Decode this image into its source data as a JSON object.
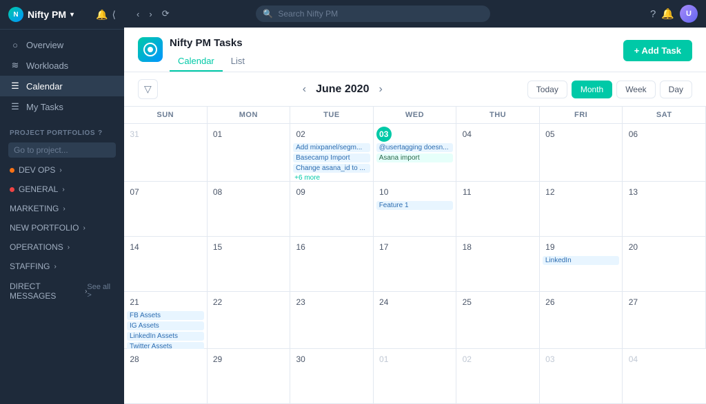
{
  "app": {
    "name": "Nifty PM",
    "search_placeholder": "Search Nifty PM"
  },
  "sidebar": {
    "nav": [
      {
        "id": "overview",
        "label": "Overview",
        "icon": "○"
      },
      {
        "id": "workloads",
        "label": "Workloads",
        "icon": "📊"
      },
      {
        "id": "calendar",
        "label": "Calendar",
        "icon": "☰",
        "active": true
      },
      {
        "id": "my-tasks",
        "label": "My Tasks",
        "icon": "☰"
      }
    ],
    "project_portfolios_label": "PROJECT PORTFOLIOS",
    "go_to_project_placeholder": "Go to project...",
    "portfolios": [
      {
        "id": "dev-ops",
        "label": "DEV OPS",
        "dot": "orange",
        "chevron": ">"
      },
      {
        "id": "general",
        "label": "GENERAL",
        "dot": "red",
        "chevron": ">"
      },
      {
        "id": "marketing",
        "label": "MARKETING",
        "chevron": ">"
      },
      {
        "id": "new-portfolio",
        "label": "NEW PORTFOLIO",
        "chevron": ">"
      },
      {
        "id": "operations",
        "label": "OPERATIONS",
        "chevron": ">"
      },
      {
        "id": "staffing",
        "label": "STAFFING",
        "chevron": ">"
      }
    ],
    "direct_messages_label": "DIRECT MESSAGES",
    "see_all_label": "See all >"
  },
  "page": {
    "title": "Nifty PM Tasks",
    "logo_text": "N",
    "tabs": [
      {
        "id": "calendar",
        "label": "Calendar",
        "active": true
      },
      {
        "id": "list",
        "label": "List"
      }
    ],
    "add_task_label": "+ Add Task"
  },
  "calendar": {
    "title": "June 2020",
    "view_buttons": [
      "Today",
      "Month",
      "Week",
      "Day"
    ],
    "active_view": "Month",
    "day_headers": [
      "SUN",
      "MON",
      "TUE",
      "WED",
      "THU",
      "FRI",
      "SAT"
    ],
    "weeks": [
      [
        {
          "day": "31",
          "other": true,
          "events": []
        },
        {
          "day": "01",
          "events": []
        },
        {
          "day": "02",
          "events": [
            {
              "text": "Add mixpanel/segm...",
              "color": "blue"
            },
            {
              "text": "Basecamp Import",
              "color": "blue"
            },
            {
              "text": "Change asana_id to ...",
              "color": "blue"
            },
            {
              "text": "+6 more",
              "more": true
            }
          ]
        },
        {
          "day": "03",
          "today": true,
          "events": [
            {
              "text": "@usertagging doesn...",
              "color": "blue"
            },
            {
              "text": "Asana import",
              "color": "green"
            }
          ]
        },
        {
          "day": "04",
          "events": []
        },
        {
          "day": "05",
          "events": []
        },
        {
          "day": "06",
          "events": []
        }
      ],
      [
        {
          "day": "07",
          "events": []
        },
        {
          "day": "08",
          "events": []
        },
        {
          "day": "09",
          "events": []
        },
        {
          "day": "10",
          "events": [
            {
              "text": "Feature 1",
              "color": "blue"
            }
          ]
        },
        {
          "day": "11",
          "events": []
        },
        {
          "day": "12",
          "events": []
        },
        {
          "day": "13",
          "events": []
        }
      ],
      [
        {
          "day": "14",
          "events": []
        },
        {
          "day": "15",
          "events": []
        },
        {
          "day": "16",
          "events": []
        },
        {
          "day": "17",
          "events": []
        },
        {
          "day": "18",
          "events": []
        },
        {
          "day": "19",
          "events": [
            {
              "text": "LinkedIn",
              "color": "blue"
            }
          ]
        },
        {
          "day": "20",
          "events": []
        }
      ],
      [
        {
          "day": "21",
          "events": [
            {
              "text": "FB Assets",
              "color": "blue"
            },
            {
              "text": "IG Assets",
              "color": "blue"
            },
            {
              "text": "LinkedIn Assets",
              "color": "blue"
            },
            {
              "text": "Twitter Assets",
              "color": "blue"
            }
          ]
        },
        {
          "day": "22",
          "events": []
        },
        {
          "day": "23",
          "events": []
        },
        {
          "day": "24",
          "events": []
        },
        {
          "day": "25",
          "events": []
        },
        {
          "day": "26",
          "events": []
        },
        {
          "day": "27",
          "events": []
        }
      ],
      [
        {
          "day": "28",
          "events": []
        },
        {
          "day": "29",
          "events": []
        },
        {
          "day": "30",
          "events": []
        },
        {
          "day": "01",
          "other": true,
          "events": []
        },
        {
          "day": "02",
          "other": true,
          "events": []
        },
        {
          "day": "03",
          "other": true,
          "events": []
        },
        {
          "day": "04",
          "other": true,
          "events": []
        }
      ]
    ]
  }
}
